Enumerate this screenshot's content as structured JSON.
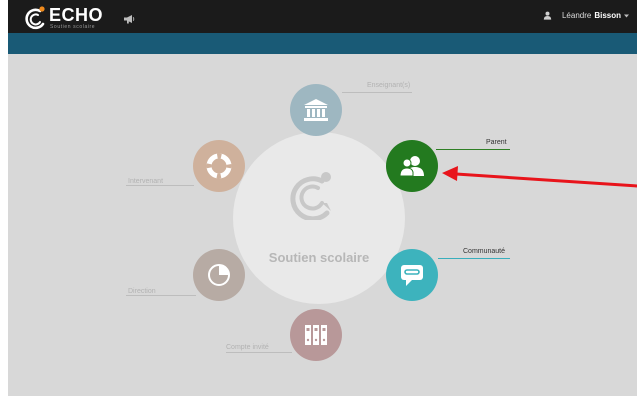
{
  "header": {
    "logo_text": "ECHO",
    "logo_subtitle": "Soutien scolaire",
    "announce_icon": "megaphone-icon",
    "user_first": "Léandre",
    "user_last": "Bisson",
    "user_icon": "user-icon"
  },
  "hub": {
    "center_label": "Soutien scolaire",
    "items": [
      {
        "label": "Enseignant(s)",
        "icon": "institution-icon",
        "color": "#9eb7c1"
      },
      {
        "label": "Parent",
        "icon": "people-icon",
        "color": "#237a1f"
      },
      {
        "label": "Communauté",
        "icon": "chat-icon",
        "color": "#3db3bd"
      },
      {
        "label": "Compte invité",
        "icon": "binders-icon",
        "color": "#b89899"
      },
      {
        "label": "Direction",
        "icon": "pie-icon",
        "color": "#b7aba4"
      },
      {
        "label": "Intervenant",
        "icon": "lifebuoy-icon",
        "color": "#cfb19c"
      }
    ]
  },
  "annotation": {
    "arrow_color": "#e8141b"
  }
}
